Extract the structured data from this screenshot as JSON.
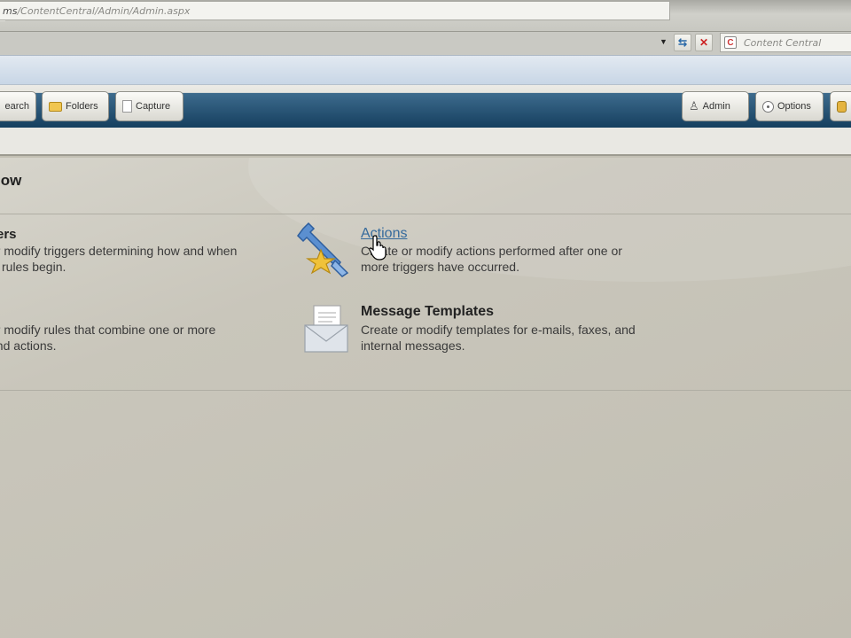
{
  "browser": {
    "url_prefix": "ms",
    "url_path": "/ContentCentral/Admin/Admin.aspx",
    "search_icon": "C",
    "search_placeholder": "Content Central"
  },
  "toolbar": {
    "search_label": "earch",
    "folders_label": "Folders",
    "capture_label": "Capture",
    "admin_label": "Admin",
    "options_label": "Options"
  },
  "page": {
    "title": "low"
  },
  "items": {
    "triggers": {
      "title": "ers",
      "desc_line1": "or modify triggers determining how and when",
      "desc_line2": "w rules begin."
    },
    "rules": {
      "desc_line1": "or modify rules that combine one or more",
      "desc_line2": "and actions."
    },
    "actions": {
      "title": "Actions",
      "desc_line1": "Create or modify actions performed after one or",
      "desc_line2": "more triggers have occurred.",
      "icon": "wrench-star-icon"
    },
    "templates": {
      "title": "Message Templates",
      "desc_line1": "Create or modify templates for e-mails, faxes, and",
      "desc_line2": "internal messages.",
      "icon": "envelope-document-icon"
    }
  },
  "colors": {
    "toolbar_dark": "#163f5f",
    "link": "#356a9c",
    "content_bg": "#c3c0b4"
  }
}
